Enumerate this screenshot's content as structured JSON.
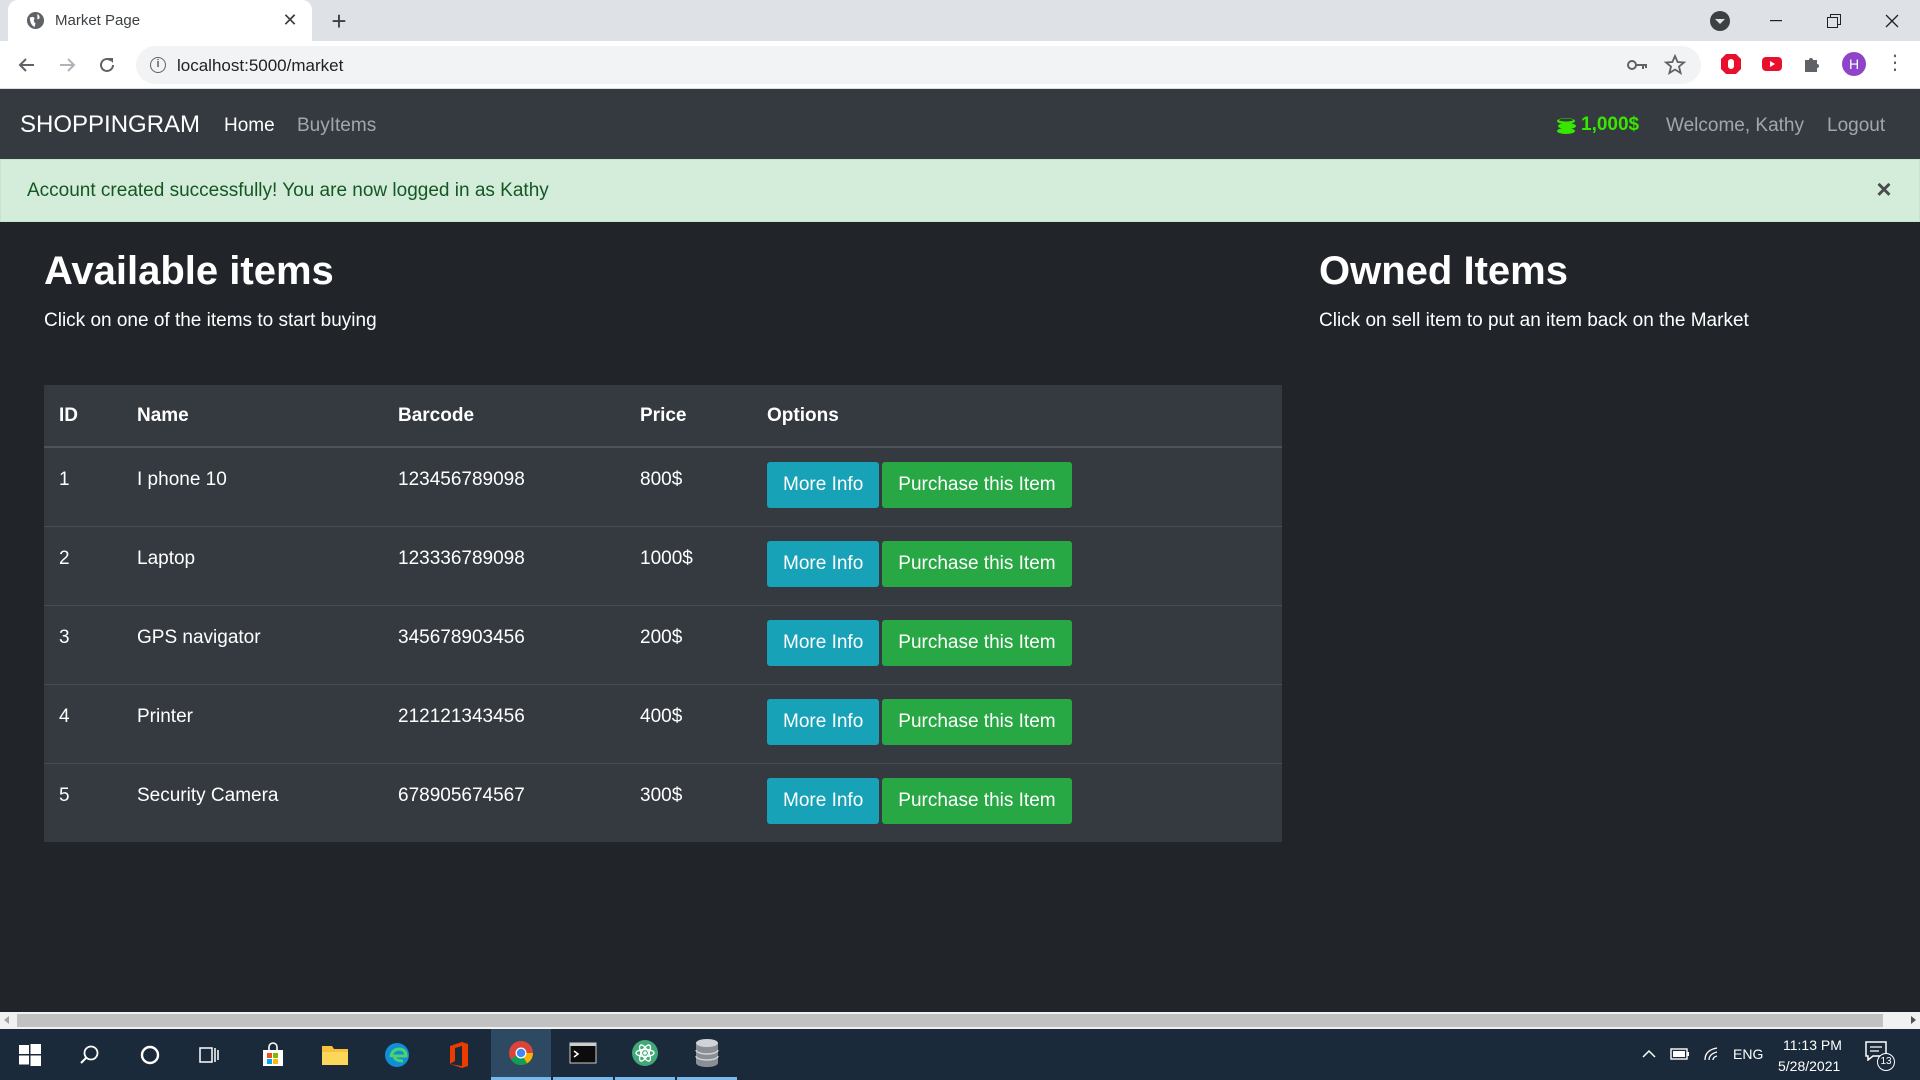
{
  "browser": {
    "tab_title": "Market Page",
    "url": "localhost:5000/market",
    "profile_initial": "H"
  },
  "navbar": {
    "brand": "SHOPPINGRAM",
    "links": [
      "Home",
      "BuyItems"
    ],
    "budget": "1,000$",
    "welcome": "Welcome, Kathy",
    "logout": "Logout"
  },
  "alert": {
    "message": "Account created successfully! You are now logged in as Kathy",
    "close": "×"
  },
  "available": {
    "title": "Available items",
    "subtitle": "Click on one of the items to start buying"
  },
  "owned": {
    "title": "Owned Items",
    "subtitle": "Click on sell item to put an item back on the Market"
  },
  "table": {
    "headers": [
      "ID",
      "Name",
      "Barcode",
      "Price",
      "Options"
    ],
    "rows": [
      {
        "id": "1",
        "name": "I phone 10",
        "barcode": "123456789098",
        "price": "800$"
      },
      {
        "id": "2",
        "name": "Laptop",
        "barcode": "123336789098",
        "price": "1000$"
      },
      {
        "id": "3",
        "name": "GPS navigator",
        "barcode": "345678903456",
        "price": "200$"
      },
      {
        "id": "4",
        "name": "Printer",
        "barcode": "212121343456",
        "price": "400$"
      },
      {
        "id": "5",
        "name": "Security Camera",
        "barcode": "678905674567",
        "price": "300$"
      }
    ],
    "more_info_label": "More Info",
    "purchase_label": "Purchase this Item"
  },
  "taskbar": {
    "language": "ENG",
    "time": "11:13 PM",
    "date": "5/28/2021",
    "notification_count": "13"
  },
  "colors": {
    "navbar_bg": "#343a40",
    "page_bg": "#212529",
    "alert_bg": "#d4edda",
    "info_button": "#17a2b8",
    "success_button": "#28a745",
    "budget_green": "#39e600"
  }
}
